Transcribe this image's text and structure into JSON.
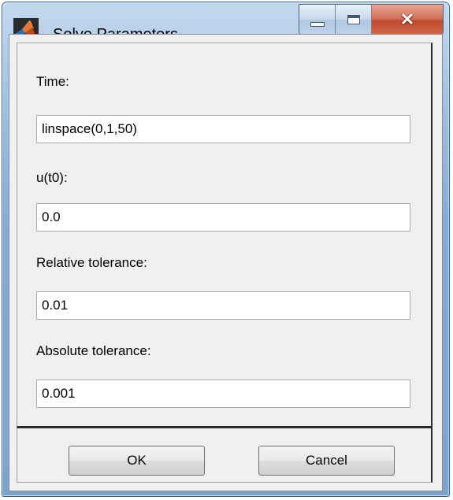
{
  "window": {
    "title": "Solve Parameters",
    "icon": "matlab-icon",
    "caption_buttons": [
      "minimize-icon",
      "maximize-icon",
      "close-icon"
    ]
  },
  "form": {
    "time": {
      "label": "Time:",
      "value": "linspace(0,1,50)"
    },
    "u_t0": {
      "label": "u(t0):",
      "value": "0.0"
    },
    "relative_tolerance": {
      "label": "Relative tolerance:",
      "value": "0.01"
    },
    "absolute_tolerance": {
      "label": "Absolute tolerance:",
      "value": "0.001"
    }
  },
  "buttons": {
    "ok_label": "OK",
    "cancel_label": "Cancel"
  },
  "colors": {
    "titlebar": "#86abd3",
    "client_bg": "#f0f0f0",
    "close_button": "#c14a2e"
  }
}
